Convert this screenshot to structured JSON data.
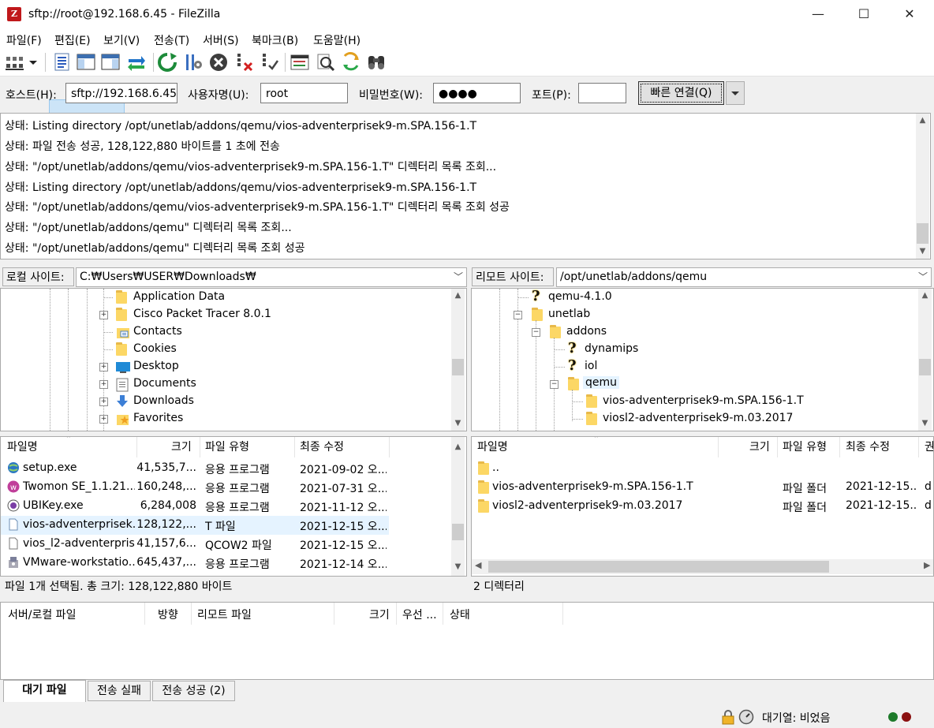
{
  "window": {
    "app_icon_letter": "Z",
    "title": "sftp://root@192.168.6.45 - FileZilla",
    "minimize": "—",
    "maximize": "☐",
    "close": "✕"
  },
  "menu": [
    "파일(F)",
    "편집(E)",
    "보기(V)",
    "전송(T)",
    "서버(S)",
    "북마크(B)",
    "도움말(H)"
  ],
  "toolbar": {
    "icons": [
      "site-manager-icon",
      "dropdown-arrow-icon",
      "toggle-log-icon",
      "toggle-local-tree-icon",
      "toggle-remote-tree-icon",
      "toggle-queue-icon",
      "refresh-icon",
      "process-queue-icon",
      "cancel-icon",
      "disconnect-icon",
      "reconnect-icon",
      "directory-listing-filters-icon",
      "compare-directories-icon",
      "synchronized-browsing-icon",
      "search-icon"
    ]
  },
  "quickconnect": {
    "host_label": "호스트(H):",
    "host_value": "sftp://192.168.6.45",
    "user_label": "사용자명(U):",
    "user_value": "root",
    "pass_label": "비밀번호(W):",
    "pass_value": "●●●●",
    "port_label": "포트(P):",
    "port_value": "",
    "connect_button": "빠른 연결(Q)"
  },
  "log": [
    {
      "label": "상태:",
      "text": "Listing directory /opt/unetlab/addons/qemu/vios-adventerprisek9-m.SPA.156-1.T"
    },
    {
      "label": "상태:",
      "text": "파일 전송 성공, 128,122,880 바이트를 1 초에 전송"
    },
    {
      "label": "상태:",
      "text": "\"/opt/unetlab/addons/qemu/vios-adventerprisek9-m.SPA.156-1.T\" 디렉터리 목록 조회..."
    },
    {
      "label": "상태:",
      "text": "Listing directory /opt/unetlab/addons/qemu/vios-adventerprisek9-m.SPA.156-1.T"
    },
    {
      "label": "상태:",
      "text": "\"/opt/unetlab/addons/qemu/vios-adventerprisek9-m.SPA.156-1.T\" 디렉터리 목록 조회 성공"
    },
    {
      "label": "상태:",
      "text": "\"/opt/unetlab/addons/qemu\" 디렉터리 목록 조회..."
    },
    {
      "label": "상태:",
      "text": "\"/opt/unetlab/addons/qemu\" 디렉터리 목록 조회 성공"
    }
  ],
  "local": {
    "site_label": "로컬 사이트:",
    "path": "C:₩Users₩USER₩Downloads₩",
    "tree": [
      "Application Data",
      "Cisco Packet Tracer 8.0.1",
      "Contacts",
      "Cookies",
      "Desktop",
      "Documents",
      "Downloads",
      "Favorites"
    ],
    "headers": [
      "파일명",
      "크기",
      "파일 유형",
      "최종 수정"
    ],
    "files": [
      {
        "name": "setup.exe",
        "size": "41,535,7...",
        "type": "응용 프로그램",
        "modified": "2021-09-02 오..."
      },
      {
        "name": "Twomon SE_1.1.21....",
        "size": "160,248,...",
        "type": "응용 프로그램",
        "modified": "2021-07-31 오..."
      },
      {
        "name": "UBIKey.exe",
        "size": "6,284,008",
        "type": "응용 프로그램",
        "modified": "2021-11-12 오..."
      },
      {
        "name": "vios-adventerprisek...",
        "size": "128,122,...",
        "type": "T 파일",
        "modified": "2021-12-15 오..."
      },
      {
        "name": "vios_l2-adventerpris...",
        "size": "41,157,6...",
        "type": "QCOW2 파일",
        "modified": "2021-12-15 오..."
      },
      {
        "name": "VMware-workstatio...",
        "size": "645,437,...",
        "type": "응용 프로그램",
        "modified": "2021-12-14 오..."
      }
    ],
    "status": "파일 1개 선택됨. 총 크기: 128,122,880 바이트"
  },
  "remote": {
    "site_label": "리모트 사이트:",
    "path": "/opt/unetlab/addons/qemu",
    "tree": [
      "qemu-4.1.0",
      "unetlab",
      "addons",
      "dynamips",
      "iol",
      "qemu",
      "vios-adventerprisek9-m.SPA.156-1.T",
      "viosl2-adventerprisek9-m.03.2017"
    ],
    "headers": [
      "파일명",
      "크기",
      "파일 유형",
      "최종 수정",
      "권"
    ],
    "files": [
      {
        "name": "..",
        "type": "",
        "modified": "",
        "perm": ""
      },
      {
        "name": "vios-adventerprisek9-m.SPA.156-1.T",
        "type": "파일 폴더",
        "modified": "2021-12-15...",
        "perm": "d"
      },
      {
        "name": "viosl2-adventerprisek9-m.03.2017",
        "type": "파일 폴더",
        "modified": "2021-12-15...",
        "perm": "d"
      }
    ],
    "status": "2 디렉터리"
  },
  "queue": {
    "headers": [
      "서버/로컬 파일",
      "방향",
      "리모트 파일",
      "크기",
      "우선 ...",
      "상태"
    ],
    "tabs": [
      "대기 파일",
      "전송 실패",
      "전송 성공 (2)"
    ]
  },
  "statusbar": {
    "queue_text": "대기열: 비었음"
  },
  "colors": {
    "folder": "#fcd765",
    "selected_row": "#e5f3ff",
    "download_arrow": "#3c7fd6"
  }
}
